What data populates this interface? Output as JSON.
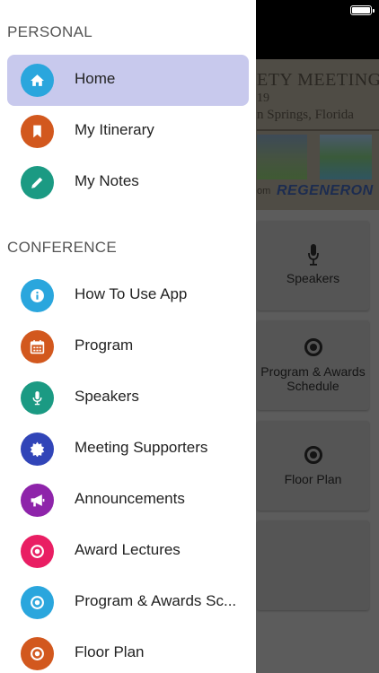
{
  "background": {
    "banner": {
      "title_fragment": "ETY MEETING",
      "year_fragment": "19",
      "location_fragment": "n Springs, Florida",
      "sponsor_prefix": "om",
      "sponsor_name": "REGENERON"
    },
    "tiles": [
      {
        "label": "Speakers",
        "icon": "microphone-icon"
      },
      {
        "label": "Program & Awards Schedule",
        "icon": "target-icon"
      },
      {
        "label": "Floor Plan",
        "icon": "target-icon"
      },
      {
        "label": "",
        "icon": ""
      }
    ]
  },
  "drawer": {
    "sections": [
      {
        "header": "PERSONAL",
        "items": [
          {
            "label": "Home",
            "icon": "home-icon",
            "color": "#2aa6dd",
            "active": true
          },
          {
            "label": "My Itinerary",
            "icon": "bookmark-icon",
            "color": "#d2581e",
            "active": false
          },
          {
            "label": "My Notes",
            "icon": "pencil-icon",
            "color": "#1b9a83",
            "active": false
          }
        ]
      },
      {
        "header": "CONFERENCE",
        "items": [
          {
            "label": "How To Use App",
            "icon": "info-icon",
            "color": "#2aa6dd"
          },
          {
            "label": "Program",
            "icon": "calendar-icon",
            "color": "#d2581e"
          },
          {
            "label": "Speakers",
            "icon": "microphone-icon",
            "color": "#1b9a83"
          },
          {
            "label": "Meeting Supporters",
            "icon": "badge-icon",
            "color": "#3145b8"
          },
          {
            "label": "Announcements",
            "icon": "megaphone-icon",
            "color": "#8e24aa"
          },
          {
            "label": "Award Lectures",
            "icon": "target-icon",
            "color": "#e91e63"
          },
          {
            "label": "Program & Awards Sc...",
            "icon": "target-icon",
            "color": "#2aa6dd"
          },
          {
            "label": "Floor Plan",
            "icon": "target-icon",
            "color": "#d2581e"
          }
        ]
      }
    ]
  }
}
